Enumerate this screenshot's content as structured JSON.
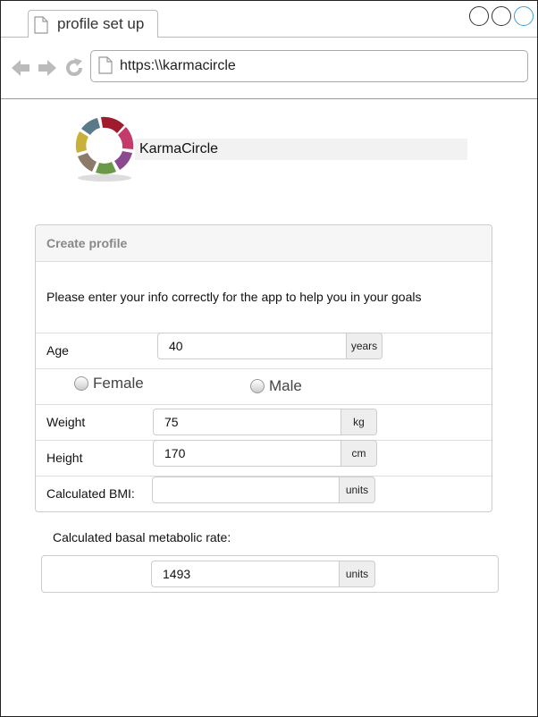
{
  "browser": {
    "tab_title": "profile set up",
    "url": "https:\\\\karmacircle"
  },
  "brand": {
    "name": "KarmaCircle"
  },
  "profile_form": {
    "title": "Create profile",
    "description": "Please enter your info correctly for the app to help you in your goals",
    "age": {
      "label": "Age",
      "value": "40",
      "unit": "years"
    },
    "gender": {
      "female": "Female",
      "male": "Male"
    },
    "weight": {
      "label": "Weight",
      "value": "75",
      "unit": "kg"
    },
    "height": {
      "label": "Height",
      "value": "170",
      "unit": "cm"
    },
    "bmi": {
      "label": "Calculated BMI:",
      "value": "",
      "unit": "units"
    }
  },
  "bmr": {
    "label": "Calculated basal metabolic rate:",
    "value": "1493",
    "unit": "units"
  }
}
